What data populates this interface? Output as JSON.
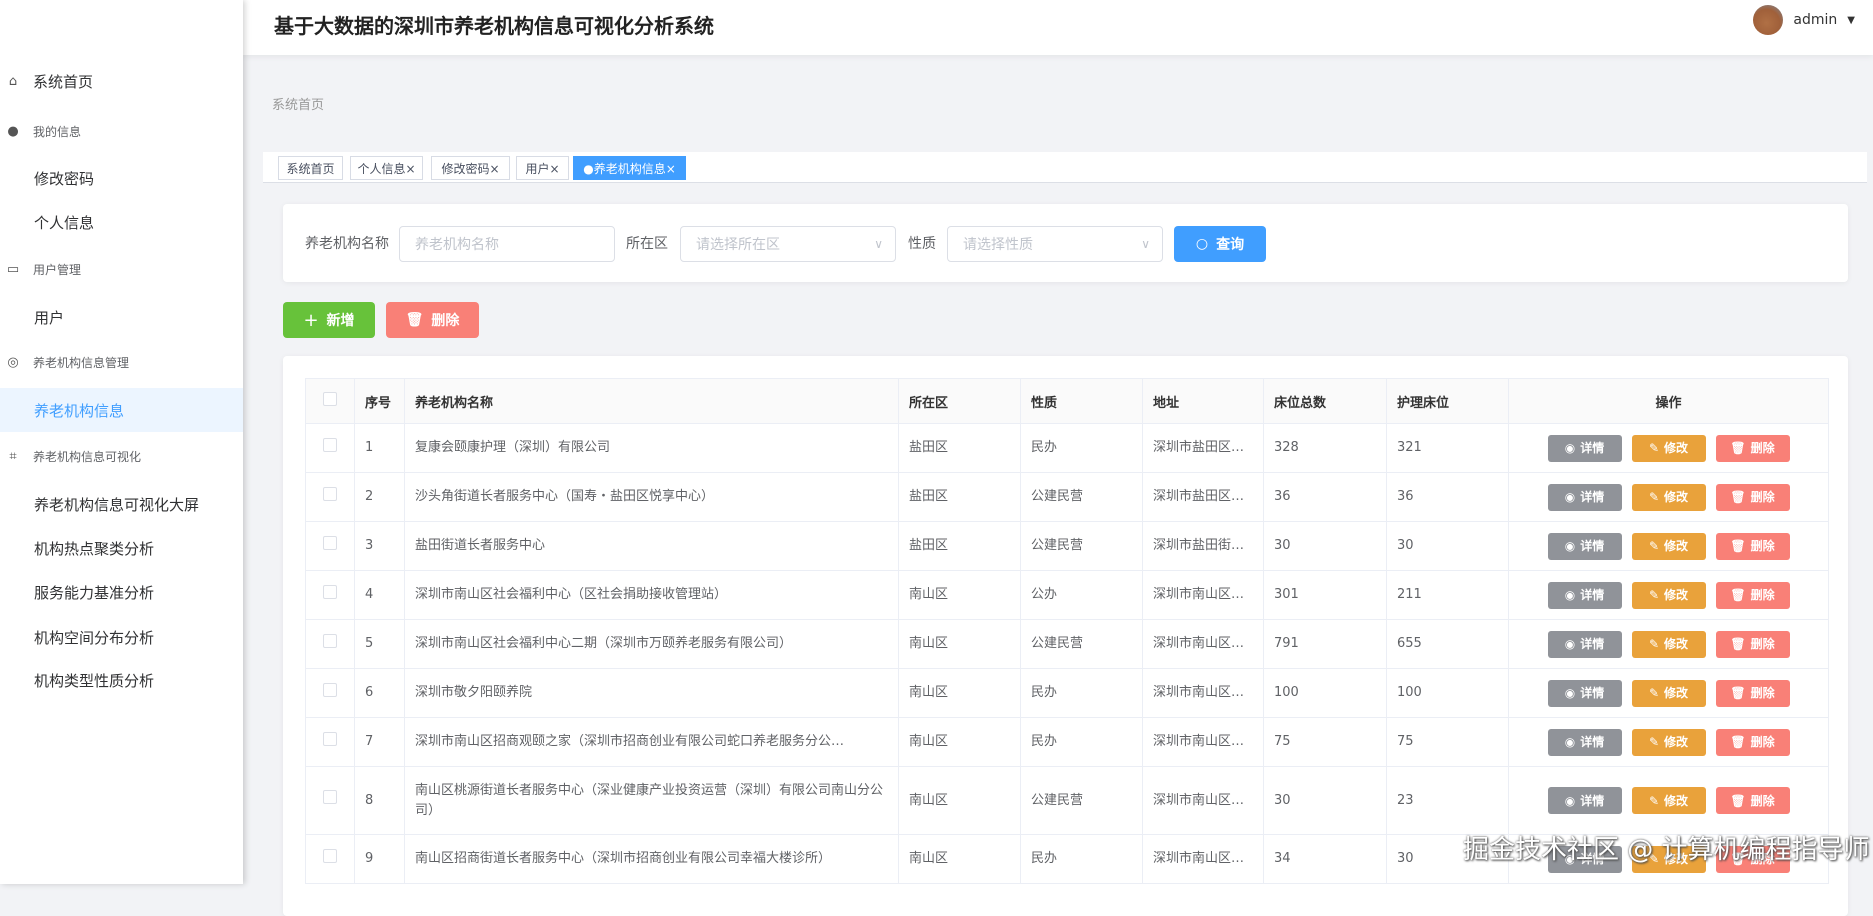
{
  "header": {
    "title": "基于大数据的深圳市养老机构信息可视化分析系统",
    "user": "admin"
  },
  "sidebar": {
    "items": [
      {
        "label": "系统首页",
        "type": "item",
        "icon": "home-icon"
      },
      {
        "label": "我的信息",
        "type": "group",
        "icon": "user-icon"
      },
      {
        "label": "修改密码",
        "type": "sub"
      },
      {
        "label": "个人信息",
        "type": "sub"
      },
      {
        "label": "用户管理",
        "type": "group",
        "icon": "message-icon"
      },
      {
        "label": "用户",
        "type": "sub"
      },
      {
        "label": "养老机构信息管理",
        "type": "group",
        "icon": "gauge-icon"
      },
      {
        "label": "养老机构信息",
        "type": "sub",
        "active": true
      },
      {
        "label": "养老机构信息可视化",
        "type": "group",
        "icon": "crop-icon"
      },
      {
        "label": "养老机构信息可视化大屏",
        "type": "sub"
      },
      {
        "label": "机构热点聚类分析",
        "type": "sub"
      },
      {
        "label": "服务能力基准分析",
        "type": "sub"
      },
      {
        "label": "机构空间分布分析",
        "type": "sub"
      },
      {
        "label": "机构类型性质分析",
        "type": "sub"
      }
    ]
  },
  "breadcrumb": "系统首页",
  "tabs": [
    {
      "label": "系统首页"
    },
    {
      "label": "个人信息×"
    },
    {
      "label": "修改密码×"
    },
    {
      "label": "用户×"
    },
    {
      "label": "●养老机构信息×",
      "active": true
    }
  ],
  "search": {
    "name_label": "养老机构名称",
    "name_placeholder": "养老机构名称",
    "district_label": "所在区",
    "district_placeholder": "请选择所在区",
    "nature_label": "性质",
    "nature_placeholder": "请选择性质",
    "query": "查询"
  },
  "actions": {
    "add": "新增",
    "delete": "删除"
  },
  "table": {
    "headers": [
      "序号",
      "养老机构名称",
      "所在区",
      "性质",
      "地址",
      "床位总数",
      "护理床位",
      "操作"
    ],
    "ops": {
      "detail": "详情",
      "edit": "修改",
      "delete": "删除"
    },
    "rows": [
      [
        "1",
        "复康会颐康护理（深圳）有限公司",
        "盐田区",
        "民办",
        "深圳市盐田区…",
        "328",
        "321"
      ],
      [
        "2",
        "沙头角街道长者服务中心（国寿・盐田区悦享中心）",
        "盐田区",
        "公建民营",
        "深圳市盐田区…",
        "36",
        "36"
      ],
      [
        "3",
        "盐田街道长者服务中心",
        "盐田区",
        "公建民营",
        "深圳市盐田街…",
        "30",
        "30"
      ],
      [
        "4",
        "深圳市南山区社会福利中心（区社会捐助接收管理站）",
        "南山区",
        "公办",
        "深圳市南山区…",
        "301",
        "211"
      ],
      [
        "5",
        "深圳市南山区社会福利中心二期（深圳市万颐养老服务有限公司）",
        "南山区",
        "公建民营",
        "深圳市南山区…",
        "791",
        "655"
      ],
      [
        "6",
        "深圳市敬夕阳颐养院",
        "南山区",
        "民办",
        "深圳市南山区…",
        "100",
        "100"
      ],
      [
        "7",
        "深圳市南山区招商观颐之家（深圳市招商创业有限公司蛇口养老服务分公…",
        "南山区",
        "民办",
        "深圳市南山区…",
        "75",
        "75"
      ],
      [
        "8",
        "南山区桃源街道长者服务中心（深业健康产业投资运营（深圳）有限公司南山分公司）",
        "南山区",
        "公建民营",
        "深圳市南山区…",
        "30",
        "23"
      ],
      [
        "9",
        "南山区招商街道长者服务中心（深圳市招商创业有限公司幸福大楼诊所）",
        "南山区",
        "民办",
        "深圳市南山区…",
        "34",
        "30"
      ]
    ]
  },
  "colors": {
    "primary": "#409eff",
    "success": "#67c23a",
    "danger": "#f98077",
    "info": "#909399",
    "warning": "#e9a23b"
  },
  "watermark": "掘金技术社区 @ 计算机编程指导师"
}
